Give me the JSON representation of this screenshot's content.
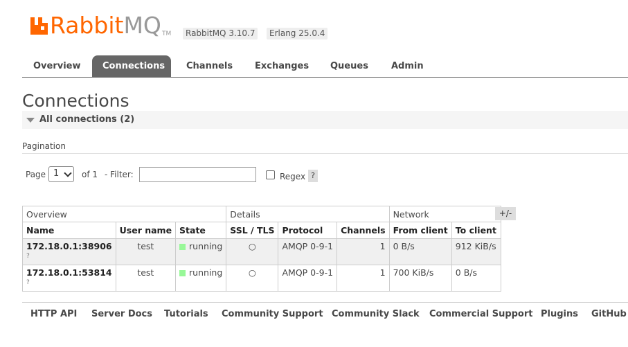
{
  "header": {
    "logo_rabbit": "Rabbit",
    "logo_mq": "MQ",
    "logo_tm": "TM",
    "rabbitmq_version": "RabbitMQ 3.10.7",
    "erlang_version": "Erlang 25.0.4",
    "brand_color": "#ff6600"
  },
  "tabs": [
    "Overview",
    "Connections",
    "Channels",
    "Exchanges",
    "Queues",
    "Admin"
  ],
  "active_tab": "Connections",
  "page_title": "Connections",
  "section": {
    "label": "All connections (2)"
  },
  "pagination": {
    "label": "Pagination",
    "page_label": "Page",
    "page_value": "1",
    "of_label": "of 1",
    "filter_label": "- Filter:",
    "filter_value": "",
    "regex_label": "Regex",
    "regex_checked": false,
    "help": "?"
  },
  "table": {
    "groups": [
      "Overview",
      "Details",
      "Network"
    ],
    "columns": [
      "Name",
      "User name",
      "State",
      "SSL / TLS",
      "Protocol",
      "Channels",
      "From client",
      "To client"
    ],
    "rows": [
      {
        "name": "172.18.0.1:38906",
        "name_hint": "?",
        "user": "test",
        "state": "running",
        "ssl": "○",
        "protocol": "AMQP 0-9-1",
        "channels": "1",
        "from_client": "0 B/s",
        "to_client": "912 KiB/s"
      },
      {
        "name": "172.18.0.1:53814",
        "name_hint": "?",
        "user": "test",
        "state": "running",
        "ssl": "○",
        "protocol": "AMQP 0-9-1",
        "channels": "1",
        "from_client": "700 KiB/s",
        "to_client": "0 B/s"
      }
    ],
    "columns_toggle": "+/-",
    "state_color": "#98f898"
  },
  "footer": [
    "HTTP API",
    "Server Docs",
    "Tutorials",
    "Community Support",
    "Community Slack",
    "Commercial Support",
    "Plugins",
    "GitHub"
  ]
}
